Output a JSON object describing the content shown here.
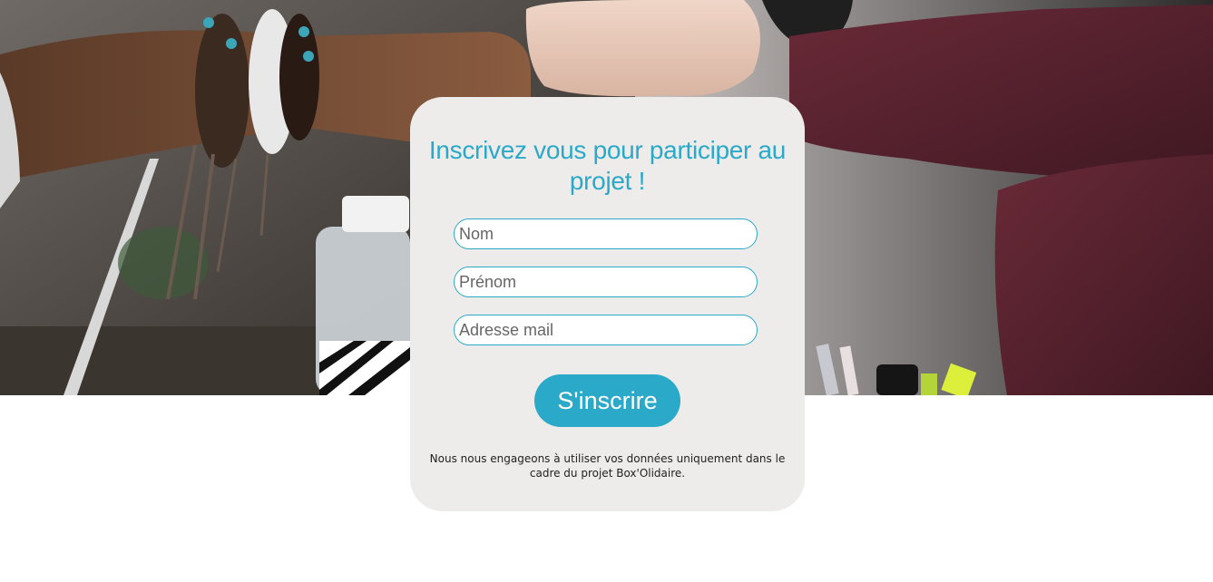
{
  "hero": {
    "image": "team-fist-bump-photo"
  },
  "form": {
    "title": "Inscrivez vous pour participer au projet !",
    "fields": {
      "nom_placeholder": "Nom",
      "prenom_placeholder": "Prénom",
      "email_placeholder": "Adresse mail"
    },
    "submit_label": "S'inscrire",
    "notice": "Nous nous engageons à utiliser vos données uniquement dans le cadre du projet Box'Olidaire."
  },
  "colors": {
    "accent": "#2aa9c9",
    "card_background": "#edecea",
    "page_background": "#ffffff"
  }
}
